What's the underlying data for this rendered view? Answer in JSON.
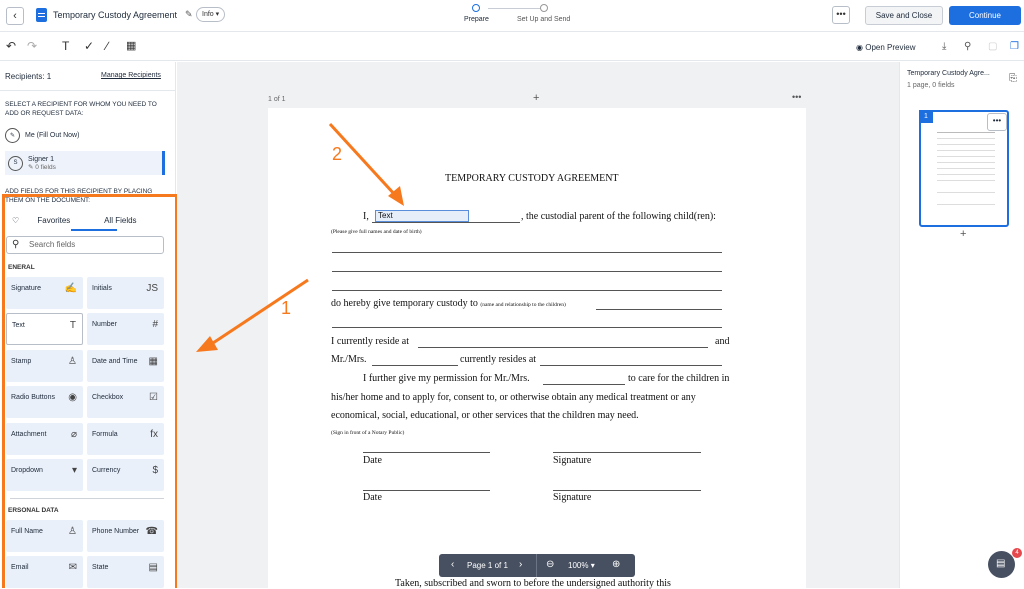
{
  "header": {
    "back_icon": "chevron-left-icon",
    "doc_title": "Temporary Custody Agreement",
    "info_label": "Info",
    "steps": [
      {
        "label": "Prepare"
      },
      {
        "label": "Set Up and Send"
      }
    ],
    "more_label": "•••",
    "save_close_label": "Save and Close",
    "continue_label": "Continue"
  },
  "toolbar": {
    "open_preview_label": "Open Preview"
  },
  "left": {
    "recipients_label": "Recipients: 1",
    "manage_label": "Manage Recipients",
    "select_instruction": "SELECT A RECIPIENT FOR WHOM YOU NEED TO ADD OR REQUEST DATA:",
    "me_label": "Me (Fill Out Now)",
    "signer_name": "Signer 1",
    "signer_fields": "0 fields",
    "signer_initial": "S",
    "add_instruction": "ADD FIELDS FOR THIS RECIPIENT BY PLACING THEM ON THE DOCUMENT:",
    "tab_favorites": "Favorites",
    "tab_all": "All Fields",
    "search_placeholder": "Search fields",
    "general_label": "ENERAL",
    "personal_label": "ERSONAL DATA",
    "general_fields": [
      {
        "label": "Signature",
        "icon": "✍"
      },
      {
        "label": "Initials",
        "icon": "JS"
      },
      {
        "label": "Text",
        "icon": "T"
      },
      {
        "label": "Number",
        "icon": "#"
      },
      {
        "label": "Stamp",
        "icon": "♙"
      },
      {
        "label": "Date and Time",
        "icon": "▦"
      },
      {
        "label": "Radio Buttons",
        "icon": "◉"
      },
      {
        "label": "Checkbox",
        "icon": "☑"
      },
      {
        "label": "Attachment",
        "icon": "⌀"
      },
      {
        "label": "Formula",
        "icon": "fx"
      },
      {
        "label": "Dropdown",
        "icon": "▾"
      },
      {
        "label": "Currency",
        "icon": "$"
      }
    ],
    "personal_fields": [
      {
        "label": "Full Name",
        "icon": "♙"
      },
      {
        "label": "Phone Number",
        "icon": "☎"
      },
      {
        "label": "Email",
        "icon": "✉"
      },
      {
        "label": "State",
        "icon": "▤"
      }
    ]
  },
  "document": {
    "page_label": "1 of 1",
    "title": "TEMPORARY CUSTODY AGREEMENT",
    "line1_prefix": "I,",
    "line1_suffix": ", the custodial parent of the following child(ren):",
    "text_field_value": "Text",
    "note1": "(Please give full names and date of birth)",
    "line_custody_a": "do hereby give temporary custody to",
    "line_custody_b": "(name and relationship to the children)",
    "line_reside_a": "I currently reside at",
    "line_reside_b": "and",
    "line_mrs_a": "Mr./Mrs.",
    "line_mrs_b": "currently resides at",
    "line_perm_a": "I further give my permission for Mr./Mrs.",
    "line_perm_b": "to care for the children in",
    "line_home": "his/her home and to apply for, consent to, or otherwise obtain any medical treatment or any",
    "line_econ": "economical, social, educational, or other services that the children may need.",
    "note2": "(Sign in front of a Notary Public)",
    "date_label": "Date",
    "signature_label": "Signature",
    "bottom_text": "Taken, subscribed and sworn to before the undersigned authority this"
  },
  "pager": {
    "page_text": "Page 1 of 1",
    "zoom": "100%"
  },
  "right": {
    "doc_title": "Temporary Custody Agre...",
    "doc_meta": "1 page, 0 fields",
    "thumb_num": "1",
    "thumb_menu": "•••",
    "add": "+"
  },
  "annotations": {
    "num1": "1",
    "num2": "2",
    "arrow_color": "#f7791e"
  },
  "chat": {
    "badge": "4"
  }
}
